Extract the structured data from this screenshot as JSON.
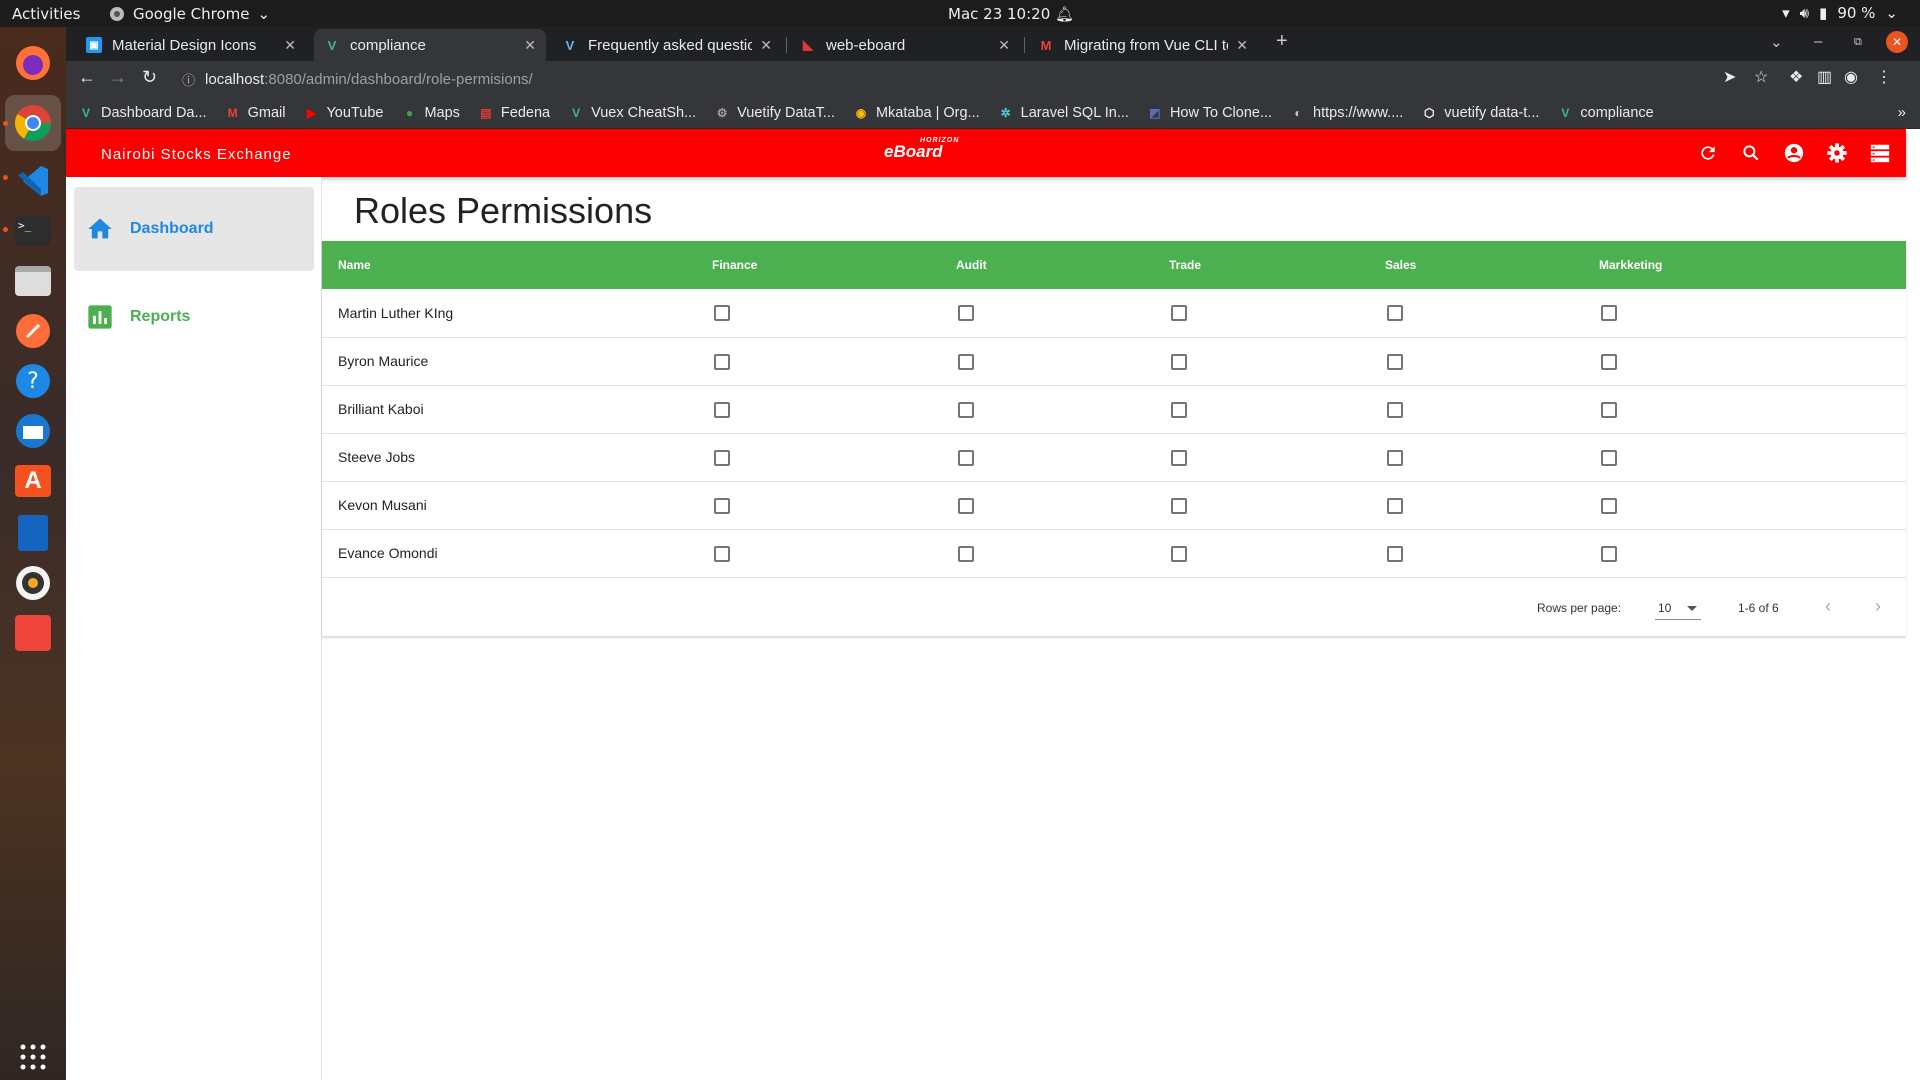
{
  "system": {
    "activities": "Activities",
    "app_name": "Google Chrome",
    "clock": "Mac 23  10:20",
    "battery": "90 %"
  },
  "tabs": [
    {
      "title": "Material Design Icons",
      "icon": "mdi-icon"
    },
    {
      "title": "compliance",
      "icon": "vue-icon"
    },
    {
      "title": "Frequently asked questio",
      "icon": "vuetify-icon"
    },
    {
      "title": "web-eboard",
      "icon": "eboard-icon"
    },
    {
      "title": "Migrating from Vue CLI to",
      "icon": "gmail-icon"
    }
  ],
  "url": {
    "host": "localhost",
    "path": ":8080/admin/dashboard/role-permisions/"
  },
  "bookmarks": [
    {
      "label": "Dashboard Da...",
      "icon": "vue-icon",
      "color": "#41b883"
    },
    {
      "label": "Gmail",
      "icon": "gmail-icon",
      "color": "#ea4335"
    },
    {
      "label": "YouTube",
      "icon": "youtube-icon",
      "color": "#ff0000"
    },
    {
      "label": "Maps",
      "icon": "maps-icon",
      "color": "#34a853"
    },
    {
      "label": "Fedena",
      "icon": "fedena-icon",
      "color": "#e53935"
    },
    {
      "label": "Vuex CheatSh...",
      "icon": "vue-icon",
      "color": "#41b883"
    },
    {
      "label": "Vuetify DataT...",
      "icon": "vuetify-icon",
      "color": "#9e9e9e"
    },
    {
      "label": "Mkataba | Org...",
      "icon": "chrome-icon",
      "color": "#fbbc05"
    },
    {
      "label": "Laravel SQL In...",
      "icon": "laravel-icon",
      "color": "#4dd0e1"
    },
    {
      "label": "How To Clone...",
      "icon": "page-icon",
      "color": "#5c6bc0"
    },
    {
      "label": "https://www....",
      "icon": "globe-icon",
      "color": "#cccccc"
    },
    {
      "label": "vuetify data-t...",
      "icon": "codepen-icon",
      "color": "#ffffff"
    },
    {
      "label": "compliance",
      "icon": "vue-icon",
      "color": "#41b883"
    }
  ],
  "app": {
    "brand": "Nairobi Stocks Exchange",
    "logo_top": "HORIZON",
    "logo_main": "eBoard",
    "accent": "#fb0000"
  },
  "sidebar": {
    "items": [
      {
        "label": "Dashboard",
        "color": "#1e88e5",
        "icon": "home-icon"
      },
      {
        "label": "Reports",
        "color": "#4caf50",
        "icon": "chart-icon"
      }
    ]
  },
  "page": {
    "title": "Roles Permissions",
    "header_color": "#4caf50",
    "columns": [
      "Name",
      "Finance",
      "Audit",
      "Trade",
      "Sales",
      "Markketing"
    ],
    "rows": [
      "Martin Luther KIng",
      "Byron Maurice",
      "Brilliant Kaboi",
      "Steeve Jobs",
      "Kevon Musani",
      "Evance Omondi"
    ],
    "footer": {
      "rows_per_page_label": "Rows per page:",
      "rows_per_page": "10",
      "range": "1-6 of 6"
    }
  }
}
